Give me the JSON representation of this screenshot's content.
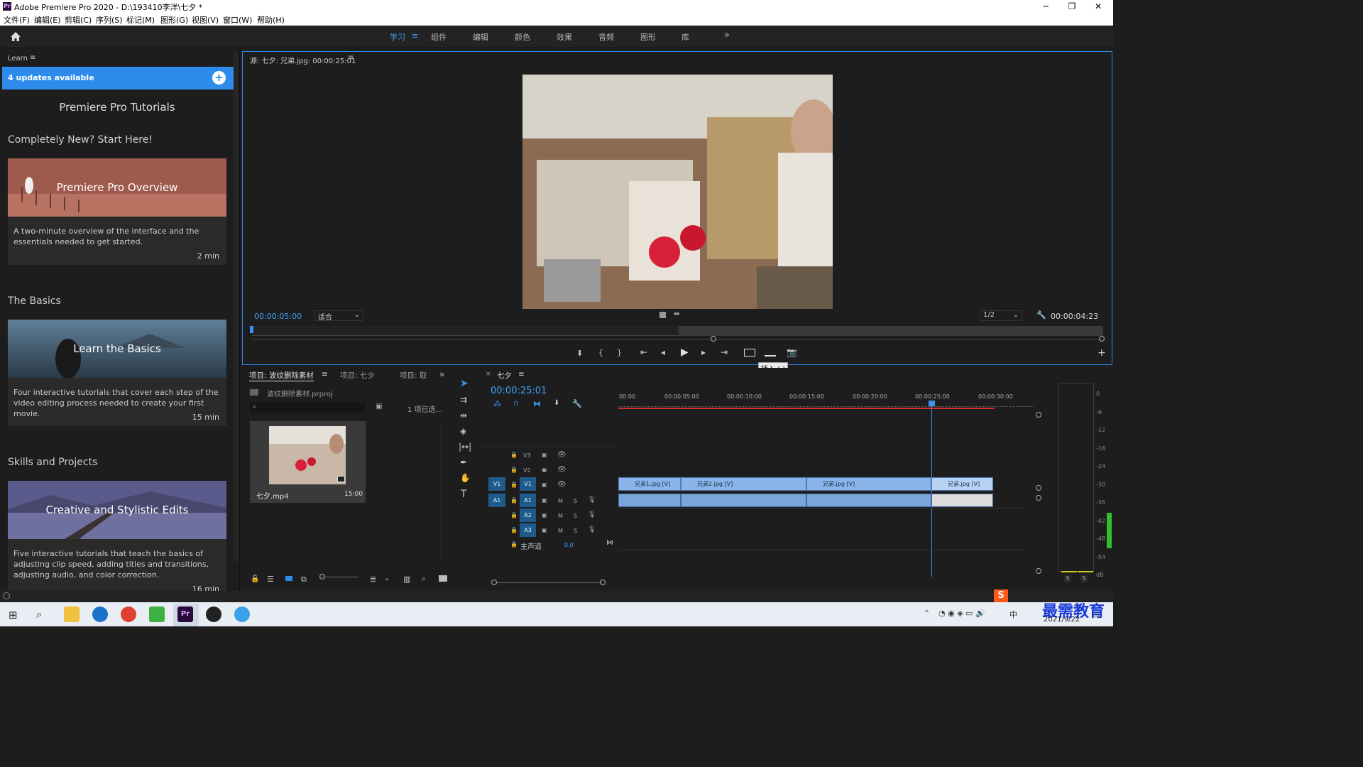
{
  "window": {
    "title": "Adobe Premiere Pro 2020 - D:\\193410李洋\\七夕 *",
    "minimize": "─",
    "maximize": "❐",
    "close": "✕"
  },
  "menu": [
    "文件(F)",
    "编辑(E)",
    "剪辑(C)",
    "序列(S)",
    "标记(M)",
    "图形(G)",
    "视图(V)",
    "窗口(W)",
    "帮助(H)"
  ],
  "workspaces": [
    "学习",
    "组件",
    "编辑",
    "颜色",
    "效果",
    "音频",
    "图形",
    "库"
  ],
  "workspace_active": "学习",
  "learn": {
    "panel_label": "Learn",
    "updates": "4 updates available",
    "heading": "Premiere Pro Tutorials",
    "sections": [
      {
        "title": "Completely New? Start Here!",
        "card_title": "Premiere Pro Overview",
        "desc": "A two-minute overview of the interface and the essentials needed to get started.",
        "duration": "2 min"
      },
      {
        "title": "The Basics",
        "card_title": "Learn the Basics",
        "desc": "Four interactive tutorials that cover each step of the video editing process needed to create your first movie.",
        "duration": "15 min"
      },
      {
        "title": "Skills and Projects",
        "card_title": "Creative and Stylistic Edits",
        "desc": "Five interactive tutorials that teach the basics of adjusting clip speed, adding titles and transitions, adjusting audio, and color correction.",
        "duration": "16 min"
      }
    ]
  },
  "source": {
    "tab": "源: 七夕: 兄弟.jpg: 00:00:25:01",
    "timecode_in": "00:00:05:00",
    "fit": "适合",
    "resolution": "1/2",
    "timecode_dur": "00:00:04:23",
    "tooltip": "插入 (,)"
  },
  "project": {
    "tabs": [
      "项目: 波纹删除素材",
      "项目: 七夕",
      "项目: 取"
    ],
    "file": "波纹删除素材.prproj",
    "selected": "1 项已选...",
    "clip_name": "七夕.mp4",
    "clip_dur": "15:00"
  },
  "timeline": {
    "tab": "七夕",
    "timecode": "00:00:25:01",
    "ruler": [
      "00:00",
      "00:00:05:00",
      "00:00:10:00",
      "00:00:15:00",
      "00:00:20:00",
      "00:00:25:00",
      "00:00:30:00"
    ],
    "tracks_video": [
      "V3",
      "V2",
      "V1"
    ],
    "tracks_audio": [
      "A1",
      "A2",
      "A3"
    ],
    "master": "主声道",
    "master_val": "0.0",
    "clips": [
      "兄弟1.jpg [V]",
      "兄弟2.jpg [V]",
      "兄弟.jpg [V]",
      "兄弟.jpg [V]"
    ]
  },
  "meter": {
    "scale": [
      "0",
      "-6",
      "-12",
      "-18",
      "-24",
      "-30",
      "-36",
      "-42",
      "-48",
      "-54",
      "dB"
    ],
    "solo": [
      "S",
      "S"
    ]
  },
  "taskbar": {
    "clock_time": "",
    "date": "2021/9/22",
    "watermark": "最需教育",
    "ime": "中"
  },
  "colors": {
    "accent": "#2d8ceb",
    "timecode": "#3fa2ff",
    "clip": "#8ab4e8",
    "playhead": "#3f8ef0"
  }
}
